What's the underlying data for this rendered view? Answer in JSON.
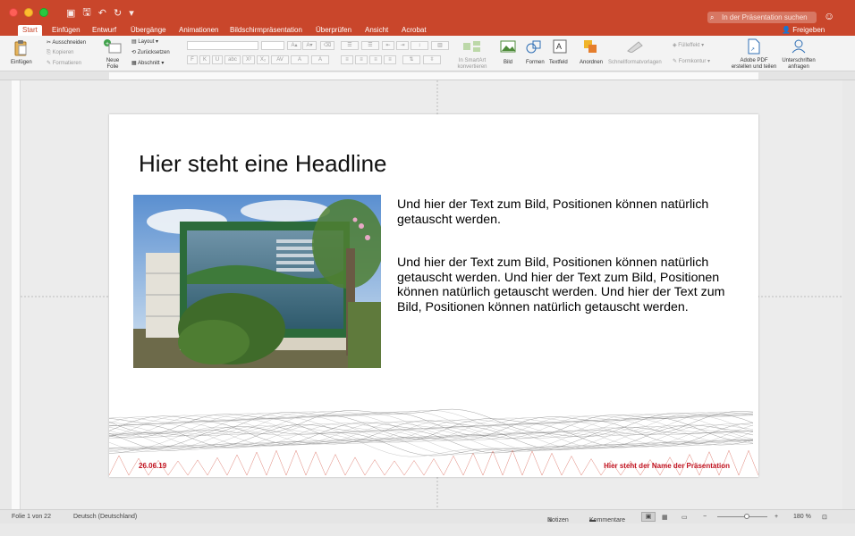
{
  "window": {
    "search_placeholder": "In der Präsentation suchen",
    "share_label": "Freigeben"
  },
  "tabs": [
    "Start",
    "Einfügen",
    "Entwurf",
    "Übergänge",
    "Animationen",
    "Bildschirmpräsentation",
    "Überprüfen",
    "Ansicht",
    "Acrobat"
  ],
  "ribbon": {
    "paste": "Einfügen",
    "cut": "Ausschneiden",
    "copy": "Kopieren",
    "format": "Formatieren",
    "new_slide": "Neue\nFolie",
    "layout": "Layout",
    "reset": "Zurücksetzen",
    "section": "Abschnitt",
    "smartart": "In SmartArt\nkonvertieren",
    "picture": "Bild",
    "shapes": "Formen",
    "textbox": "Textfeld",
    "arrange": "Anordnen",
    "quickstyles": "Schnellformatvorlagen",
    "fill": "Fülleffekt",
    "outline": "Formkontur",
    "adobe": "Adobe PDF\nerstellen und teilen",
    "signatures": "Unterschriften\nanfragen"
  },
  "slide": {
    "headline": "Hier steht eine Headline",
    "para1": "Und hier der Text zum Bild, Positionen können natürlich getauscht werden.",
    "para2": "Und hier der Text zum Bild, Positionen können natürlich getauscht werden. Und hier der Text zum Bild, Positionen können natürlich getauscht werden. Und hier der Text zum Bild, Positionen können natürlich getauscht werden.",
    "footer_date": "26.06.19",
    "footer_name": "Hier steht der Name der Präsentation"
  },
  "status": {
    "slide_info": "Folie 1 von 22",
    "language": "Deutsch (Deutschland)",
    "notes": "Notizen",
    "comments": "Kommentare",
    "zoom": "180 %"
  },
  "colors": {
    "accent": "#c9462b",
    "footer_red": "#c0121f"
  }
}
